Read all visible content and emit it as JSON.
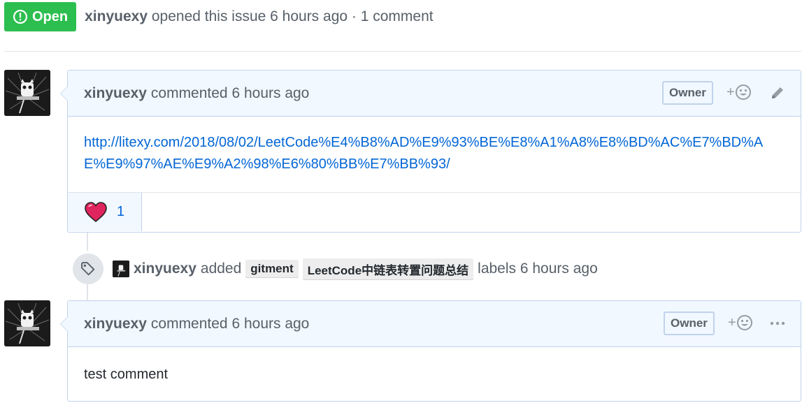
{
  "issue": {
    "state": "Open",
    "author": "xinyuexy",
    "opened_text": "opened this issue 6 hours ago · 1 comment"
  },
  "comments": [
    {
      "author": "xinyuexy",
      "meta": "commented 6 hours ago",
      "owner_label": "Owner",
      "react_plus": "+",
      "body_link": "http://litexy.com/2018/08/02/LeetCode%E4%B8%AD%E9%93%BE%E8%A1%A8%E8%BD%AC%E7%BD%AE%E9%97%AE%E9%A2%98%E6%80%BB%E7%BB%93/",
      "reaction_icon": "heart-icon",
      "reaction_count": "1",
      "action_icon": "pencil-icon"
    },
    {
      "author": "xinyuexy",
      "meta": "commented 6 hours ago",
      "owner_label": "Owner",
      "react_plus": "+",
      "body_text": "test comment",
      "action_icon": "kebab-horizontal-icon"
    }
  ],
  "label_event": {
    "icon": "tag-icon",
    "author": "xinyuexy",
    "action": "added",
    "labels": [
      "gitment",
      "LeetCode中链表转置问题总结"
    ],
    "tail": "labels 6 hours ago"
  },
  "colors": {
    "open_green": "#2cbe4e",
    "link_blue": "#0366d6",
    "header_bg": "#f1f8ff",
    "border_blue": "#c0d3eb",
    "heart_red": "#e0245e"
  }
}
